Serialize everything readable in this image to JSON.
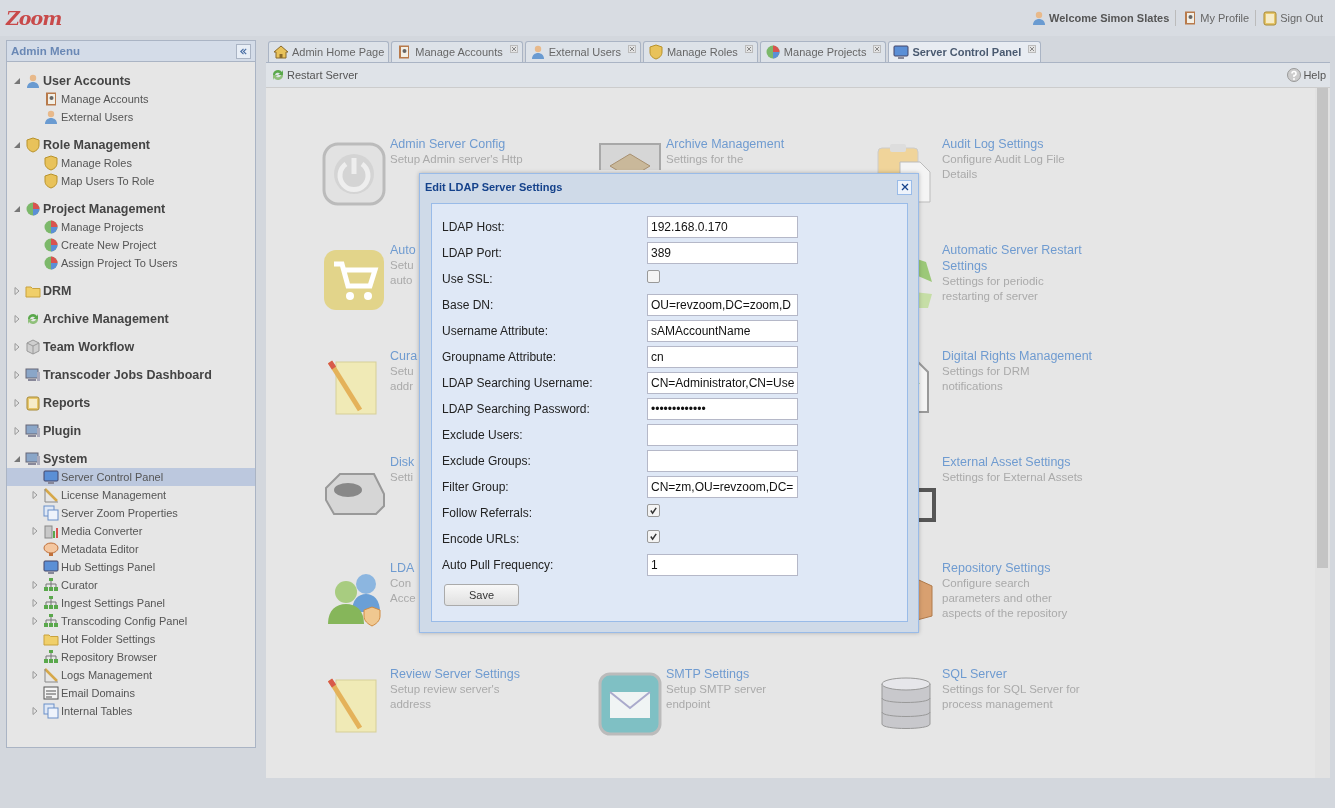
{
  "header": {
    "logo": "Zoom",
    "welcome": "Welcome Simon Slates",
    "links": [
      "My Profile",
      "Sign Out"
    ]
  },
  "sidebar": {
    "title": "Admin Menu",
    "groups": [
      {
        "label": "User Accounts",
        "kind": "user",
        "expanded": true,
        "children": [
          {
            "label": "Manage Accounts",
            "kind": "book",
            "expandable": false,
            "selected": false
          },
          {
            "label": "External Users",
            "kind": "user",
            "expandable": false,
            "selected": false
          }
        ]
      },
      {
        "label": "Role Management",
        "kind": "shield",
        "expanded": true,
        "children": [
          {
            "label": "Manage Roles",
            "kind": "shield",
            "expandable": false,
            "selected": false
          },
          {
            "label": "Map Users To Role",
            "kind": "shield",
            "expandable": false,
            "selected": false
          }
        ]
      },
      {
        "label": "Project Management",
        "kind": "globe",
        "expanded": true,
        "children": [
          {
            "label": "Manage Projects",
            "kind": "globe",
            "expandable": false,
            "selected": false
          },
          {
            "label": "Create New Project",
            "kind": "globe",
            "expandable": false,
            "selected": false
          },
          {
            "label": "Assign Project To Users",
            "kind": "globe",
            "expandable": false,
            "selected": false
          }
        ]
      },
      {
        "label": "DRM",
        "kind": "folder",
        "expanded": false
      },
      {
        "label": "Archive Management",
        "kind": "recycle",
        "expanded": false
      },
      {
        "label": "Team Workflow",
        "kind": "cube",
        "expanded": false
      },
      {
        "label": "Transcoder Jobs Dashboard",
        "kind": "monitor",
        "expanded": false
      },
      {
        "label": "Reports",
        "kind": "clipboard",
        "expanded": false
      },
      {
        "label": "Plugin",
        "kind": "monitor",
        "expanded": false
      },
      {
        "label": "System",
        "kind": "monitor",
        "expanded": true,
        "children": [
          {
            "label": "Server Control Panel",
            "kind": "screen",
            "expandable": false,
            "selected": true
          },
          {
            "label": "License Management",
            "kind": "ruler",
            "expandable": true,
            "selected": false
          },
          {
            "label": "Server Zoom Properties",
            "kind": "pages",
            "expandable": false,
            "selected": false
          },
          {
            "label": "Media Converter",
            "kind": "chart",
            "expandable": true,
            "selected": false
          },
          {
            "label": "Metadata Editor",
            "kind": "badge",
            "expandable": false,
            "selected": false
          },
          {
            "label": "Hub Settings Panel",
            "kind": "screen",
            "expandable": false,
            "selected": false
          },
          {
            "label": "Curator",
            "kind": "network",
            "expandable": true,
            "selected": false
          },
          {
            "label": "Ingest Settings Panel",
            "kind": "network",
            "expandable": true,
            "selected": false
          },
          {
            "label": "Transcoding Config Panel",
            "kind": "network",
            "expandable": true,
            "selected": false
          },
          {
            "label": "Hot Folder Settings",
            "kind": "folder",
            "expandable": false,
            "selected": false
          },
          {
            "label": "Repository Browser",
            "kind": "network",
            "expandable": false,
            "selected": false
          },
          {
            "label": "Logs Management",
            "kind": "ruler",
            "expandable": true,
            "selected": false
          },
          {
            "label": "Email Domains",
            "kind": "list",
            "expandable": false,
            "selected": false
          },
          {
            "label": "Internal Tables",
            "kind": "pages",
            "expandable": true,
            "selected": false
          }
        ]
      }
    ]
  },
  "tabs": [
    {
      "label": "Admin Home Page",
      "kind": "home",
      "closable": false,
      "selected": false
    },
    {
      "label": "Manage Accounts",
      "kind": "book",
      "closable": true,
      "selected": false
    },
    {
      "label": "External Users",
      "kind": "user",
      "closable": true,
      "selected": false
    },
    {
      "label": "Manage Roles",
      "kind": "shield",
      "closable": true,
      "selected": false
    },
    {
      "label": "Manage Projects",
      "kind": "globe",
      "closable": true,
      "selected": false
    },
    {
      "label": "Server Control Panel",
      "kind": "screen",
      "closable": true,
      "selected": true
    }
  ],
  "toolbar": {
    "button": "Restart Server",
    "help": "Help"
  },
  "tiles": [
    [
      {
        "kind": "power",
        "title": "Admin Server Config",
        "lines": [
          "Setup Admin server's Http"
        ]
      },
      {
        "kind": "box",
        "title": "Archive Management",
        "lines": [
          "Settings for the"
        ]
      },
      {
        "kind": "clipboard",
        "title": "Audit Log Settings",
        "lines": [
          "Configure Audit Log File",
          "Details"
        ]
      }
    ],
    [
      {
        "kind": "cart",
        "title": "Auto",
        "lines": [
          "Setu",
          "auto"
        ]
      },
      {
        "kind": "recycle",
        "title": "Automatic Server Restart Settings",
        "lines": [
          "Settings for periodic",
          "restarting of server"
        ]
      }
    ],
    [
      {
        "kind": "notepad",
        "title": "Cura",
        "lines": [
          "Setu",
          "addr"
        ]
      },
      {
        "kind": "document",
        "title": "Digital Rights Management",
        "lines": [
          "Settings for DRM",
          "notifications"
        ]
      }
    ],
    [
      {
        "kind": "disk",
        "title": "Disk",
        "lines": [
          "Setti"
        ]
      },
      {
        "kind": "monitor",
        "title": "External Asset Settings",
        "lines": [
          "Settings for External Assets"
        ]
      }
    ],
    [
      {
        "kind": "users",
        "title": "LDA",
        "lines": [
          "Con",
          "Acce"
        ]
      },
      {
        "kind": "crate",
        "title": "Repository Settings",
        "lines": [
          "Configure search",
          "parameters and other",
          "aspects of the repository"
        ]
      }
    ],
    [
      {
        "kind": "notepad",
        "title": "Review Server Settings",
        "lines": [
          "Setup review server's",
          "address"
        ]
      },
      {
        "kind": "mail",
        "title": "SMTP Settings",
        "lines": [
          "Setup SMTP server",
          "endpoint"
        ]
      },
      {
        "kind": "database",
        "title": "SQL Server",
        "lines": [
          "Settings for SQL Server for",
          "process management"
        ]
      }
    ]
  ],
  "dialog": {
    "title": "Edit LDAP Server Settings",
    "fields": [
      {
        "label": "LDAP Host:",
        "kind": "text",
        "value": "192.168.0.170"
      },
      {
        "label": "LDAP Port:",
        "kind": "text",
        "value": "389"
      },
      {
        "label": "Use SSL:",
        "kind": "checkbox",
        "checked": false
      },
      {
        "label": "Base DN:",
        "kind": "text",
        "value": "OU=revzoom,DC=zoom,D"
      },
      {
        "label": "Username Attribute:",
        "kind": "text",
        "value": "sAMAccountName"
      },
      {
        "label": "Groupname Attribute:",
        "kind": "text",
        "value": "cn"
      },
      {
        "label": "LDAP Searching Username:",
        "kind": "text",
        "value": "CN=Administrator,CN=Use"
      },
      {
        "label": "LDAP Searching Password:",
        "kind": "text",
        "value": "•••••••••••••"
      },
      {
        "label": "Exclude Users:",
        "kind": "text"
      },
      {
        "label": "Exclude Groups:",
        "kind": "text"
      },
      {
        "label": "Filter Group:",
        "kind": "text",
        "value": "CN=zm,OU=revzoom,DC="
      },
      {
        "label": "Follow Referrals:",
        "kind": "checkbox",
        "checked": true
      },
      {
        "label": "Encode URLs:",
        "kind": "checkbox",
        "checked": true
      },
      {
        "label": "Auto Pull Frequency:",
        "kind": "text",
        "value": "1"
      }
    ],
    "button": "Save"
  }
}
